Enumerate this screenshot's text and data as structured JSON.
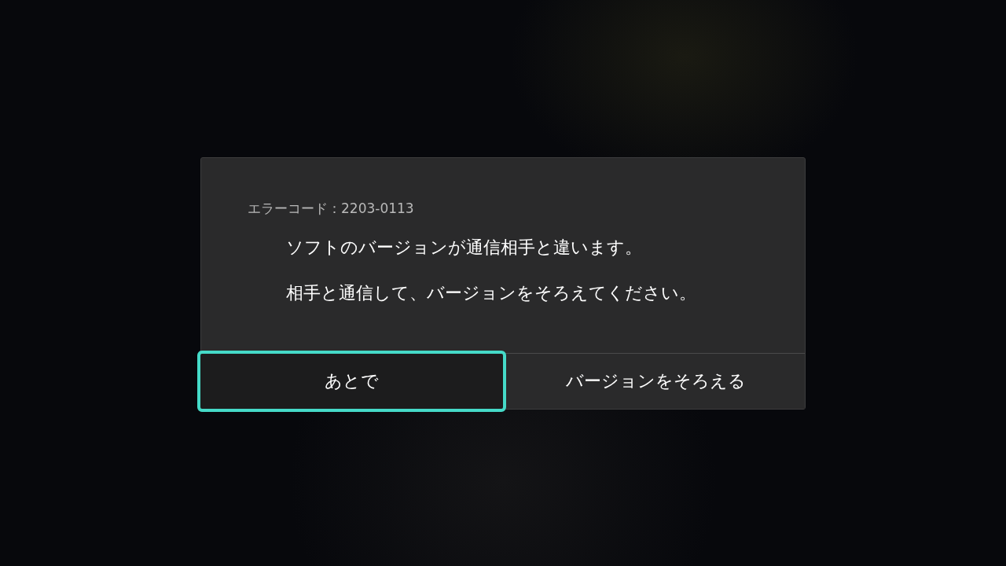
{
  "dialog": {
    "error_code": "エラーコード：2203-0113",
    "messages": [
      "ソフトのバージョンが通信相手と違います。",
      "相手と通信して、バージョンをそろえてください。"
    ],
    "buttons": [
      {
        "label": "あとで",
        "selected": true
      },
      {
        "label": "バージョンをそろえる",
        "selected": false
      }
    ]
  }
}
